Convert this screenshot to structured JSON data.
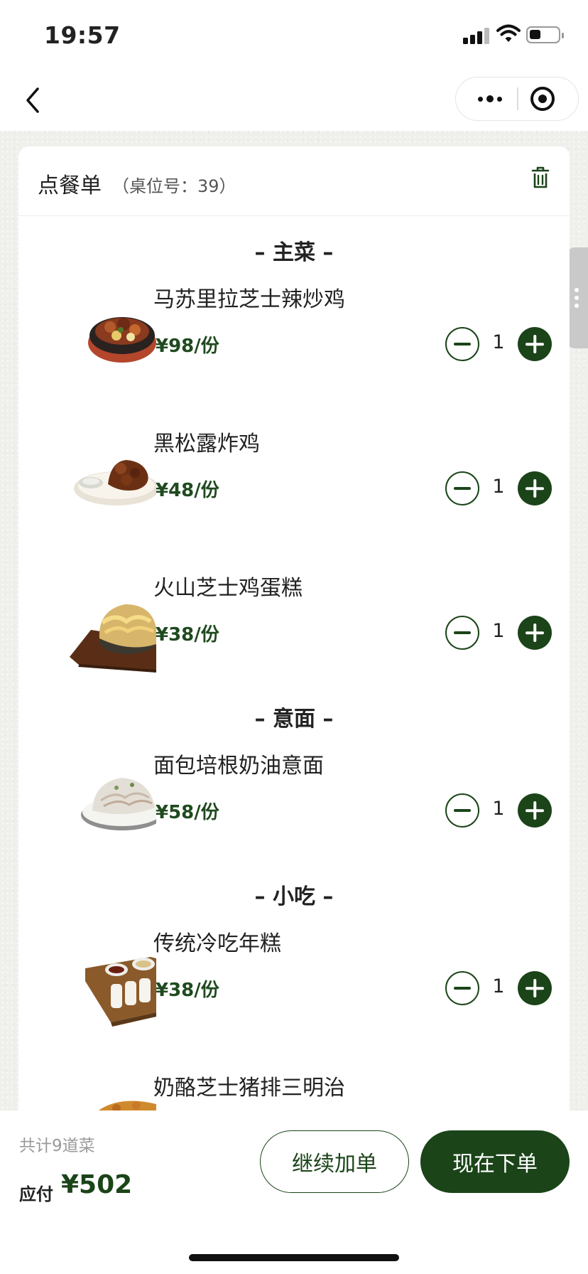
{
  "status_bar": {
    "time": "19:57"
  },
  "order": {
    "title": "点餐单",
    "table_label": "（桌位号：39）"
  },
  "sections": [
    {
      "title": "– 主菜 –",
      "items": [
        {
          "name": "马苏里拉芝士辣炒鸡",
          "price": "¥98/份",
          "qty": "1",
          "image": "spicy-chicken-photo"
        },
        {
          "name": "黑松露炸鸡",
          "price": "¥48/份",
          "qty": "1",
          "image": "fried-chicken-photo"
        },
        {
          "name": "火山芝士鸡蛋糕",
          "price": "¥38/份",
          "qty": "1",
          "image": "cheese-egg-cake-photo"
        }
      ]
    },
    {
      "title": "– 意面 –",
      "items": [
        {
          "name": "面包培根奶油意面",
          "price": "¥58/份",
          "qty": "1",
          "image": "cream-pasta-photo"
        }
      ]
    },
    {
      "title": "– 小吃 –",
      "items": [
        {
          "name": "传统冷吃年糕",
          "price": "¥38/份",
          "qty": "1",
          "image": "rice-cake-photo"
        },
        {
          "name": "奶酪芝士猪排三明治",
          "image": "pork-sandwich-photo"
        }
      ]
    }
  ],
  "summary": {
    "count_text": "共计9道菜",
    "pay_label": "应付",
    "pay_amount": "¥502"
  },
  "buttons": {
    "continue": "继续加单",
    "order_now": "现在下单"
  },
  "colors": {
    "accent": "#1b4419",
    "price": "#1f4a1f",
    "background": "#efefec"
  },
  "icons": [
    "back-icon",
    "more-icon",
    "close-icon",
    "trash-icon",
    "minus-icon",
    "plus-icon",
    "signal-icon",
    "wifi-icon",
    "battery-icon"
  ]
}
